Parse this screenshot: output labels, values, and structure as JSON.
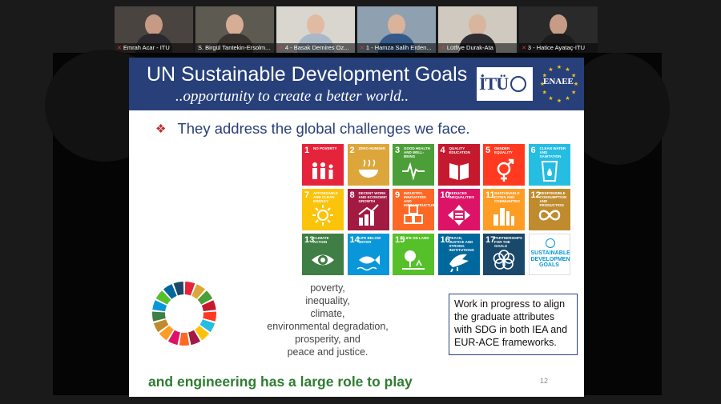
{
  "participants": [
    {
      "name": "Emrah Acar - ITU",
      "bg": "#4a4440",
      "head": "#c79a84",
      "body": "#2a2a2e"
    },
    {
      "name": "S. Birgül Tantekin-Ersolm...",
      "bg": "#5d5a52",
      "head": "#d7ad95",
      "body": "#3a3430"
    },
    {
      "name": "4 - Basak Demires Oz...",
      "bg": "#d9d6d0",
      "head": "#e0bba2",
      "body": "#a9b8c9"
    },
    {
      "name": "1 - Hamza Salih Erden...",
      "bg": "#8fa0b0",
      "head": "#d9b49a",
      "body": "#355a8a"
    },
    {
      "name": "Lütfiye Durak-Ata",
      "bg": "#cfc9c0",
      "head": "#d8b59c",
      "body": "#2d2d32"
    },
    {
      "name": "3 - Hatice Ayataç-ITU",
      "bg": "#2a2a2a",
      "head": "#c79c86",
      "body": "#1c1c1c"
    }
  ],
  "slide": {
    "title": "UN Sustainable Development Goals",
    "subtitle": "..opportunity to create a better world..",
    "itu_logo": "İTÜ",
    "enaee_logo": "ENAEE",
    "bullet_text": "They address the global challenges we face.",
    "challenges": [
      "poverty,",
      "inequality,",
      "climate,",
      "environmental degradation,",
      "prosperity, and",
      "peace and justice."
    ],
    "info_box": "Work in progress to align the graduate attributes with SDG in both IEA and EUR-ACE frameworks.",
    "footer": "and engineering has a large role to play",
    "page_number": "12"
  },
  "sdgs": [
    {
      "num": "1",
      "label": "NO POVERTY",
      "color": "#e5243b",
      "icon": "people-icon"
    },
    {
      "num": "2",
      "label": "ZERO HUNGER",
      "color": "#dda63a",
      "icon": "bowl-icon"
    },
    {
      "num": "3",
      "label": "GOOD HEALTH AND WELL-BEING",
      "color": "#4c9f38",
      "icon": "heartbeat-icon"
    },
    {
      "num": "4",
      "label": "QUALITY EDUCATION",
      "color": "#c5192d",
      "icon": "book-icon"
    },
    {
      "num": "5",
      "label": "GENDER EQUALITY",
      "color": "#ff3a21",
      "icon": "gender-icon"
    },
    {
      "num": "6",
      "label": "CLEAN WATER AND SANITATION",
      "color": "#26bde2",
      "icon": "water-drop-icon"
    },
    {
      "num": "7",
      "label": "AFFORDABLE AND CLEAN ENERGY",
      "color": "#fcc30b",
      "icon": "sun-icon"
    },
    {
      "num": "8",
      "label": "DECENT WORK AND ECONOMIC GROWTH",
      "color": "#a21942",
      "icon": "growth-chart-icon"
    },
    {
      "num": "9",
      "label": "INDUSTRY, INNOVATION AND INFRASTRUCTURE",
      "color": "#fd6925",
      "icon": "cubes-icon"
    },
    {
      "num": "10",
      "label": "REDUCED INEQUALITIES",
      "color": "#dd1367",
      "icon": "arrows-icon"
    },
    {
      "num": "11",
      "label": "SUSTAINABLE CITIES AND COMMUNITIES",
      "color": "#fd9d24",
      "icon": "city-icon"
    },
    {
      "num": "12",
      "label": "RESPONSIBLE CONSUMPTION AND PRODUCTION",
      "color": "#bf8b2e",
      "icon": "infinity-icon"
    },
    {
      "num": "13",
      "label": "CLIMATE ACTION",
      "color": "#3f7e44",
      "icon": "eye-globe-icon"
    },
    {
      "num": "14",
      "label": "LIFE BELOW WATER",
      "color": "#0a97d9",
      "icon": "fish-icon"
    },
    {
      "num": "15",
      "label": "LIFE ON LAND",
      "color": "#56c02b",
      "icon": "tree-icon"
    },
    {
      "num": "16",
      "label": "PEACE, JUSTICE AND STRONG INSTITUTIONS",
      "color": "#00689d",
      "icon": "dove-icon"
    },
    {
      "num": "17",
      "label": "PARTNERSHIPS FOR THE GOALS",
      "color": "#19486a",
      "icon": "flower-icon"
    }
  ],
  "sdg_logo": {
    "lines": [
      "SUSTAINABLE",
      "DEVELOPMENT",
      "GOALS"
    ],
    "color": "#0a97d9"
  }
}
